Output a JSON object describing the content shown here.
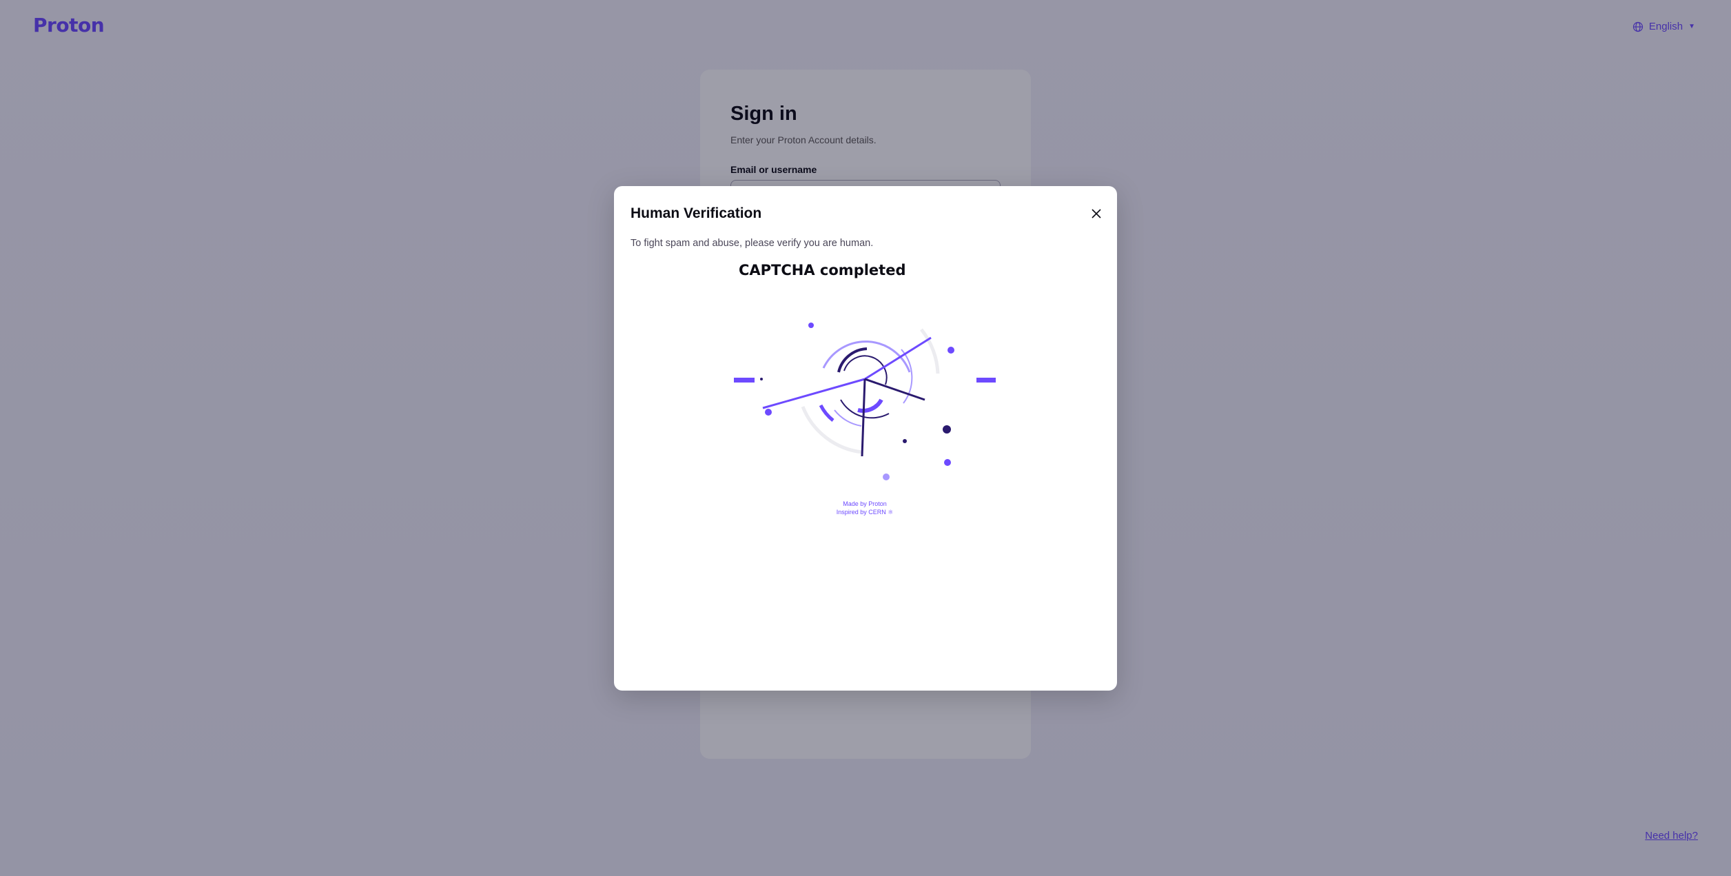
{
  "header": {
    "logo_text": "Proton",
    "language": "English",
    "language_icon": "globe-icon"
  },
  "signin": {
    "title": "Sign in",
    "subtitle": "Enter your Proton Account details.",
    "email_label": "Email or username",
    "email_value": ""
  },
  "footer": {
    "help_link": "Need help?"
  },
  "modal": {
    "title": "Human Verification",
    "close_icon": "close-icon",
    "description": "To fight spam and abuse, please verify you are human.",
    "captcha_status": "CAPTCHA completed",
    "credit_line1": "Made by Proton",
    "credit_line2": "Inspired by CERN",
    "credit_icon": "atom-icon"
  },
  "colors": {
    "brand": "#6d4aff",
    "dark_purple": "#2a1a6e",
    "light_purple": "#a898ff",
    "arc_gray": "#ececf0"
  }
}
